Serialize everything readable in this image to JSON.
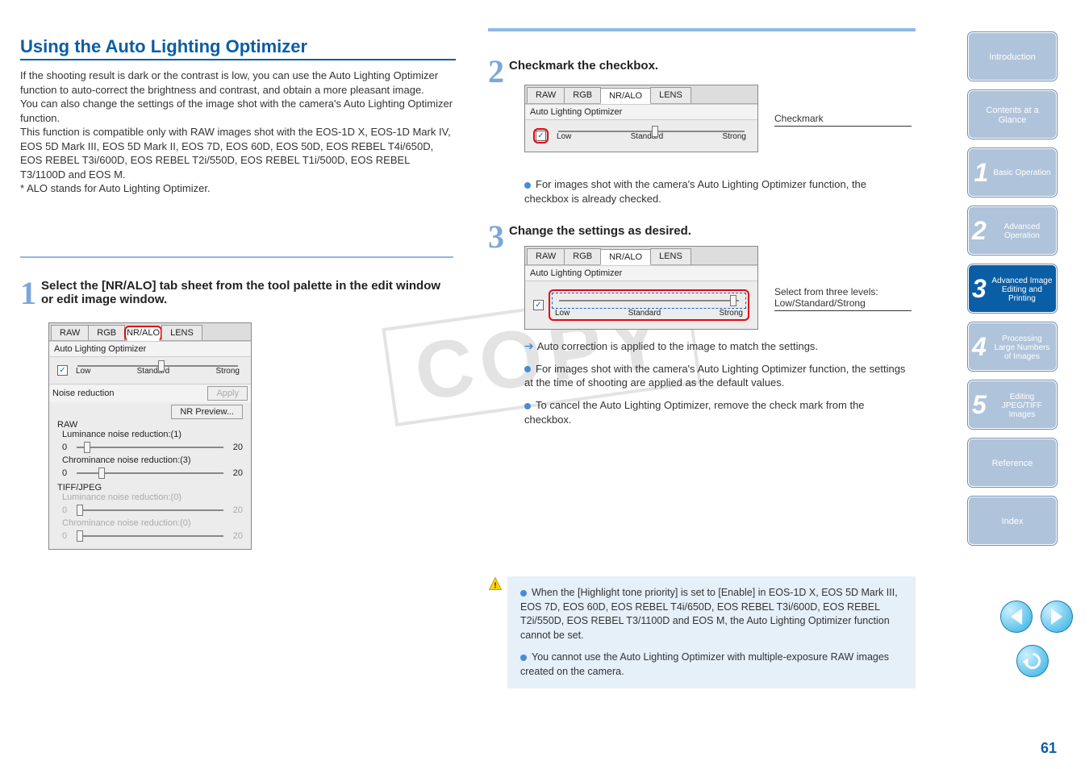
{
  "heading_left": "Using the Auto Lighting Optimizer",
  "body_left": "If the shooting result is dark or the contrast is low, you can use the Auto Lighting Optimizer function to auto-correct the brightness and contrast, and obtain a more pleasant image.\nYou can also change the settings of the image shot with the camera's Auto Lighting Optimizer function.\nThis function is compatible only with RAW images shot with the EOS-1D X, EOS-1D Mark IV, EOS 5D Mark III, EOS 5D Mark II, EOS 7D, EOS 60D, EOS 50D, EOS REBEL T4i/650D, EOS REBEL T3i/600D, EOS REBEL T2i/550D, EOS REBEL T1i/500D, EOS REBEL T3/1100D and EOS M.\n* ALO stands for Auto Lighting Optimizer.",
  "step1": {
    "num": "1",
    "title": "Select the [NR/ALO] tab sheet from the tool palette in the edit window or edit image window."
  },
  "step2": {
    "num": "2",
    "title": "Checkmark the checkbox.",
    "note": "For images shot with the camera's Auto Lighting Optimizer function, the checkbox is already checked.",
    "caption": "Checkmark"
  },
  "step3": {
    "num": "3",
    "title": "Change the settings as desired.",
    "caption": "Select from three levels: Low/Standard/Strong",
    "result": "Auto correction is applied to the image to match the settings.",
    "note1": "For images shot with the camera's Auto Lighting Optimizer function, the settings at the time of shooting are applied as the default values.",
    "note2": "To cancel the Auto Lighting Optimizer, remove the check mark from the checkbox."
  },
  "palette": {
    "tabs": [
      "RAW",
      "RGB",
      "NR/ALO",
      "LENS"
    ],
    "alo_label": "Auto Lighting Optimizer",
    "slider_labels": [
      "Low",
      "Standard",
      "Strong"
    ],
    "nr_label": "Noise reduction",
    "apply": "Apply",
    "nr_preview": "NR Preview...",
    "raw_label": "RAW",
    "lum_label": "Luminance noise reduction:(1)",
    "chrom_label": "Chrominance noise reduction:(3)",
    "tiff_label": "TIFF/JPEG",
    "lum0_label": "Luminance noise reduction:(0)",
    "chrom0_label": "Chrominance noise reduction:(0)",
    "min": "0",
    "max": "20"
  },
  "warnings": {
    "w1": "When the [Highlight tone priority] is set to [Enable] in EOS-1D X, EOS 5D Mark III, EOS 7D, EOS 60D, EOS REBEL T4i/650D, EOS REBEL T3i/600D, EOS REBEL T2i/550D, EOS REBEL T3/1100D and EOS M, the Auto Lighting Optimizer function cannot be set.",
    "w2": "You cannot use the Auto Lighting Optimizer with multiple-exposure RAW images created on the camera."
  },
  "sidenav": {
    "intro": "Introduction",
    "contents": "Contents at a Glance",
    "s1": {
      "n": "1",
      "t": "Basic Operation"
    },
    "s2": {
      "n": "2",
      "t": "Advanced Operation"
    },
    "s3": {
      "n": "3",
      "t": "Advanced Image Editing and Printing"
    },
    "s4": {
      "n": "4",
      "t": "Processing Large Numbers of Images"
    },
    "s5": {
      "n": "5",
      "t": "Editing JPEG/TIFF Images"
    },
    "ref": "Reference",
    "index": "Index"
  },
  "watermark": "COPY",
  "pagenum": "61"
}
